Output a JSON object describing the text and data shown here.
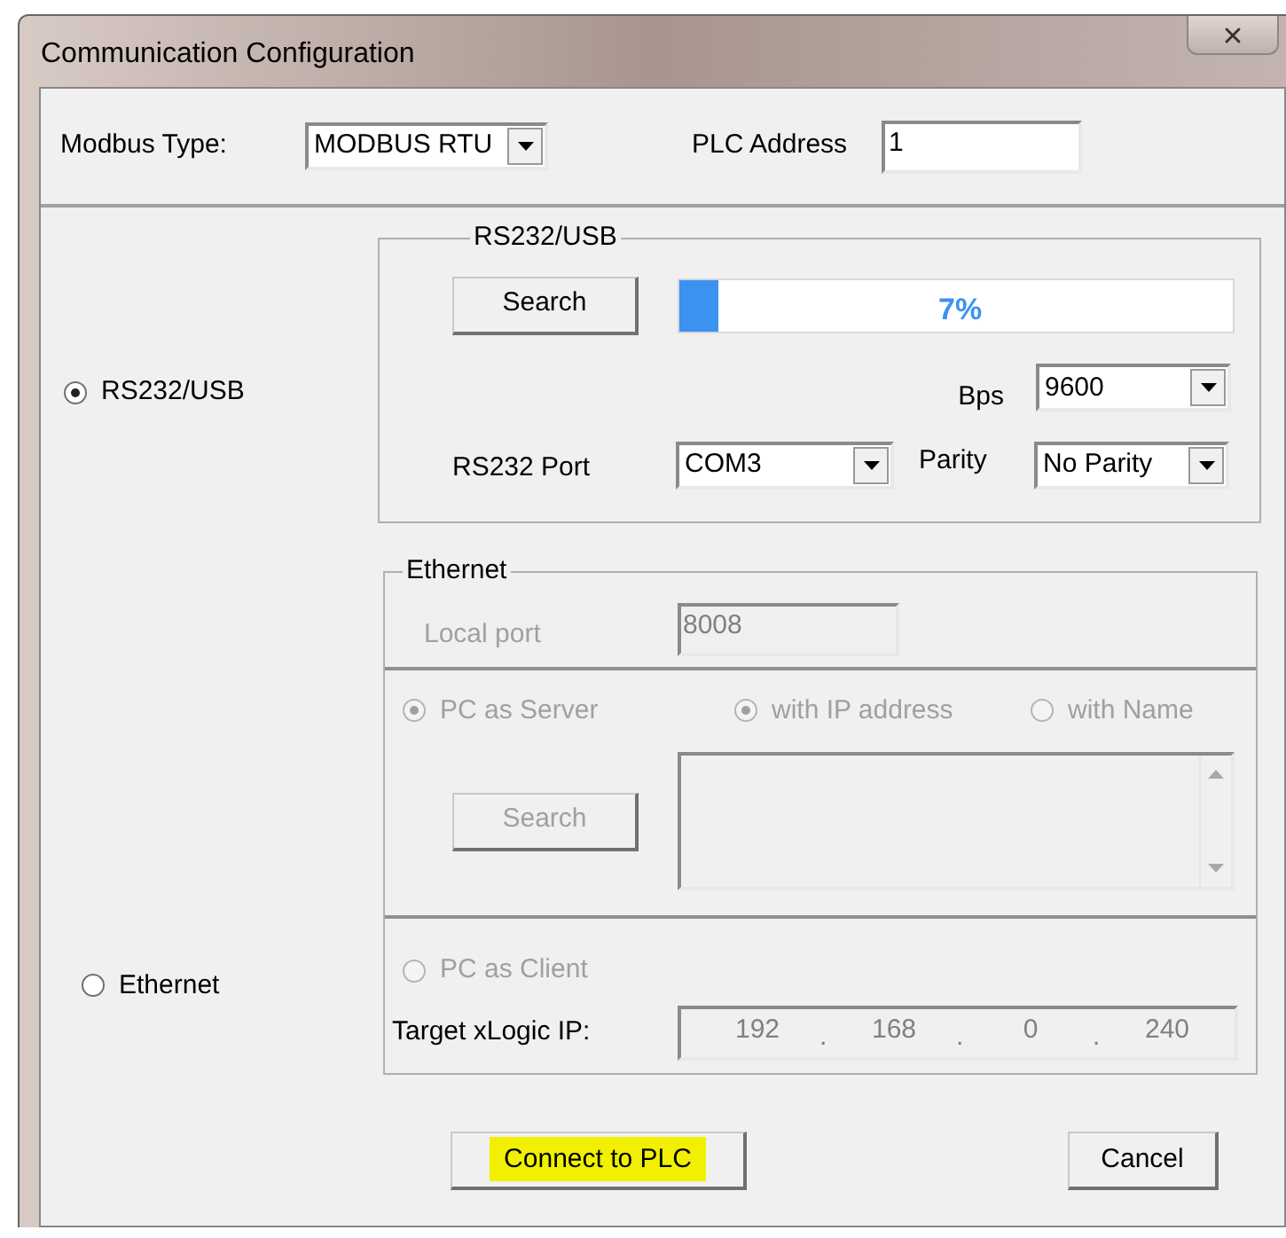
{
  "window": {
    "title": "Communication Configuration"
  },
  "top": {
    "modbus_type_label": "Modbus Type:",
    "modbus_type": "MODBUS RTU",
    "plc_address_label": "PLC Address",
    "plc_address": "1"
  },
  "connection_radios": [
    {
      "label": "RS232/USB",
      "selected": true
    },
    {
      "label": "Ethernet",
      "selected": false
    }
  ],
  "rs232": {
    "title": "RS232/USB",
    "search": "Search",
    "progress": {
      "level": 0.07,
      "reading": "7%"
    },
    "bps_label": "Bps",
    "bps": "9600",
    "port_label": "RS232 Port",
    "port": "COM3",
    "parity_label": "Parity",
    "parity": "No Parity"
  },
  "ethernet": {
    "title": "Ethernet",
    "disabled": true,
    "local_port_label": "Local port",
    "local_port": "8008",
    "pc_as_server": {
      "label": "PC as Server",
      "selected": true
    },
    "address_modes": [
      {
        "label": "with IP address",
        "selected": true
      },
      {
        "label": "with Name",
        "selected": false
      }
    ],
    "search": "Search",
    "pc_as_client": {
      "label": "PC as Client",
      "selected": false
    },
    "target_ip_label": "Target xLogic IP:",
    "target_ip": [
      "192",
      "168",
      "0",
      "240"
    ],
    "target_ip_separator": "."
  },
  "buttons": [
    {
      "label": "Connect to PLC",
      "highlighted": true
    },
    {
      "label": "Cancel",
      "highlighted": false
    }
  ]
}
